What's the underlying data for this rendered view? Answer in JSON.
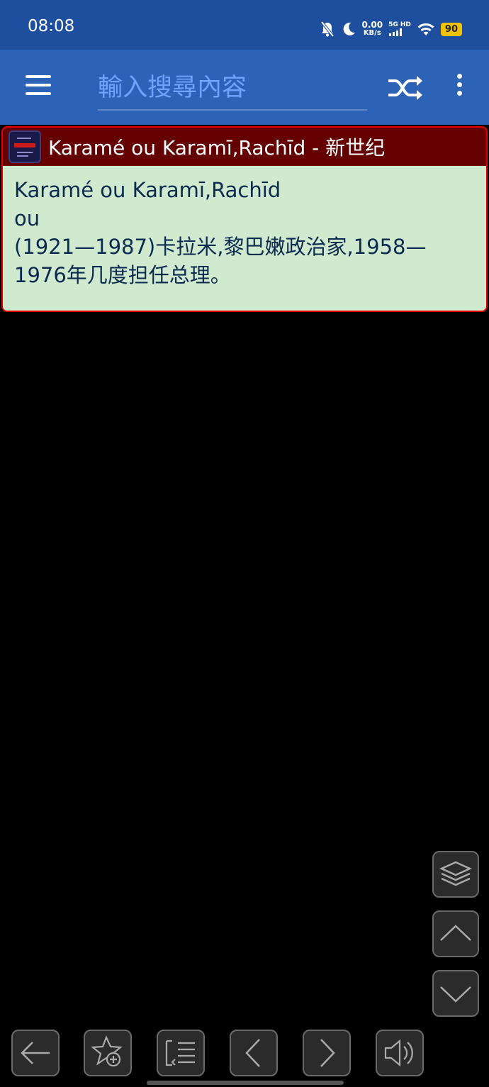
{
  "status_bar": {
    "time": "08:08",
    "net_speed": "0.00",
    "net_unit": "KB/s",
    "network": "5G HD",
    "battery": "90",
    "icons": [
      "mute-bell-icon",
      "moon-icon",
      "wifi-icon",
      "battery-icon"
    ]
  },
  "toolbar": {
    "search_placeholder": "輸入搜尋內容",
    "icons": [
      "menu-icon",
      "shuffle-icon",
      "more-vert-icon"
    ]
  },
  "entry": {
    "header_title": "Karamé ou Karamī,Rachīd - 新世纪",
    "line1": "Karamé ou Karamī,Rachīd",
    "line2": "ou",
    "line3": "(1921—1987)卡拉米,黎巴嫩政治家,1958—1976年几度担任总理。"
  },
  "side_buttons": [
    "layers-icon",
    "chevron-up-icon",
    "chevron-down-icon"
  ],
  "bottom_bar": [
    "back-arrow-icon",
    "favorite-add-icon",
    "list-icon",
    "prev-icon",
    "next-icon",
    "speaker-icon"
  ],
  "colors": {
    "status_bg": "#1e4e9e",
    "toolbar_bg": "#2d63b6",
    "card_header_bg": "#650000",
    "card_border": "#e40000",
    "card_body_bg": "#d0ead0",
    "card_text": "#0b2a4e"
  }
}
